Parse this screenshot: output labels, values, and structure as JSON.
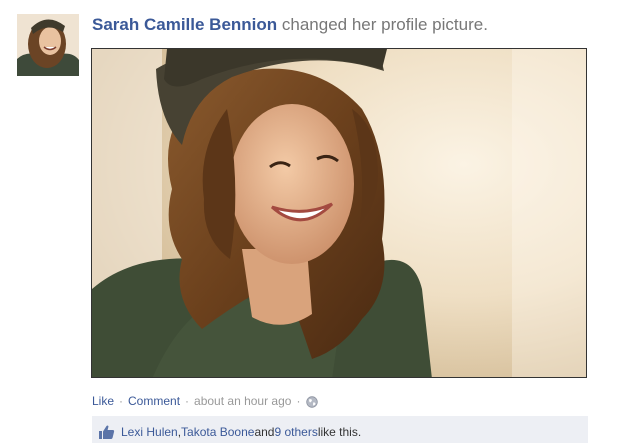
{
  "story": {
    "author_name": "Sarah Camille Bennion",
    "action_text": " changed her profile picture."
  },
  "actions": {
    "like_label": "Like",
    "comment_label": "Comment",
    "separator": "·",
    "timestamp": "about an hour ago"
  },
  "likes": {
    "person_1": "Lexi Hulen",
    "comma": ", ",
    "person_2": "Takota Boone",
    "and_text": " and ",
    "others_label": "9 others",
    "suffix": " like this."
  },
  "icons": {
    "audience": "globe-icon",
    "like": "thumbs-up-icon"
  },
  "colors": {
    "link": "#3b5998",
    "muted": "#999999",
    "likes_background": "#edeff4"
  }
}
